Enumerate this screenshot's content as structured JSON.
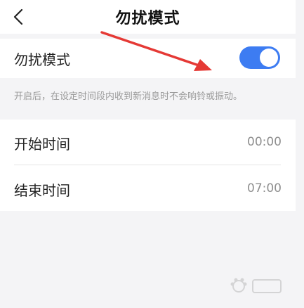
{
  "header": {
    "title": "勿扰模式",
    "back_icon": "chevron-left-icon"
  },
  "dnd": {
    "label": "勿扰模式",
    "enabled": true,
    "toggle_color": "#3d7cf2"
  },
  "hint": "开启后，在设定时间段内收到新消息时不会响铃或振动。",
  "schedule": [
    {
      "label": "开始时间",
      "value": "00:00"
    },
    {
      "label": "结束时间",
      "value": "07:00"
    }
  ],
  "annotation": {
    "arrow_color": "#e53935"
  }
}
